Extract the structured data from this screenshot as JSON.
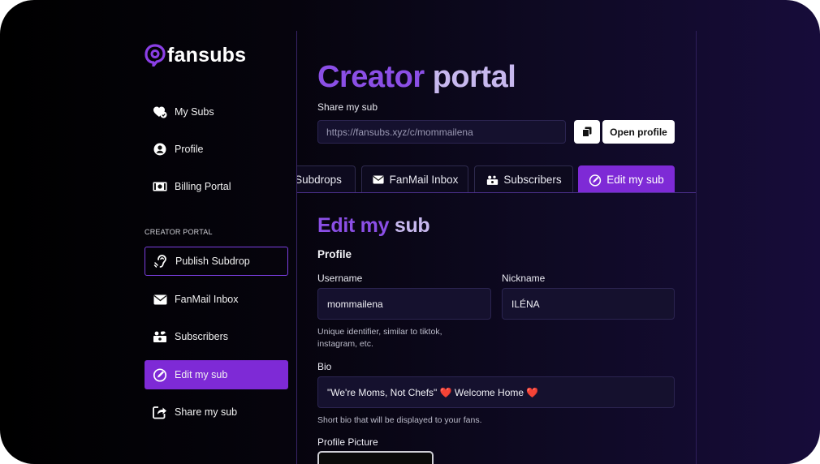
{
  "brand": {
    "name": "fansubs"
  },
  "sidebar": {
    "items": [
      {
        "label": "My Subs",
        "icon": "heart-plus-icon"
      },
      {
        "label": "Profile",
        "icon": "user-circle-icon"
      },
      {
        "label": "Billing Portal",
        "icon": "money-icon"
      }
    ],
    "section_label": "CREATOR PORTAL",
    "creator_items": [
      {
        "label": "Publish Subdrop",
        "icon": "ear-icon"
      },
      {
        "label": "FanMail Inbox",
        "icon": "envelope-icon"
      },
      {
        "label": "Subscribers",
        "icon": "subscribers-icon"
      },
      {
        "label": "Edit my sub",
        "icon": "pencil-circle-icon"
      },
      {
        "label": "Share my sub",
        "icon": "share-icon"
      }
    ]
  },
  "main": {
    "title_part1": "Creator",
    "title_part2": "portal",
    "share_label": "Share my sub",
    "share_url": "https://fansubs.xyz/c/mommailena",
    "open_profile_label": "Open profile",
    "tabs": [
      {
        "label": "Subdrops",
        "icon": ""
      },
      {
        "label": "FanMail Inbox",
        "icon": "envelope-icon"
      },
      {
        "label": "Subscribers",
        "icon": "subscribers-icon"
      },
      {
        "label": "Edit my sub",
        "icon": "pencil-circle-icon"
      }
    ],
    "active_tab": "Edit my sub"
  },
  "edit": {
    "title_part1": "Edit my",
    "title_part2": "sub",
    "profile_heading": "Profile",
    "username_label": "Username",
    "username_value": "mommailena",
    "username_help_line1": "Unique identifier, similar to tiktok,",
    "username_help_line2": "instagram, etc.",
    "nickname_label": "Nickname",
    "nickname_value": "ILÉNA",
    "bio_label": "Bio",
    "bio_value": "\"We're Moms, Not Chefs\" ❤️ Welcome Home ❤️",
    "bio_help": "Short bio that will be displayed to your fans.",
    "picture_label": "Profile Picture"
  },
  "colors": {
    "accent": "#7e2ad6",
    "accent_text": "#8b4fe6",
    "title_light": "#c7b8ee",
    "input_bg": "#15112e"
  }
}
